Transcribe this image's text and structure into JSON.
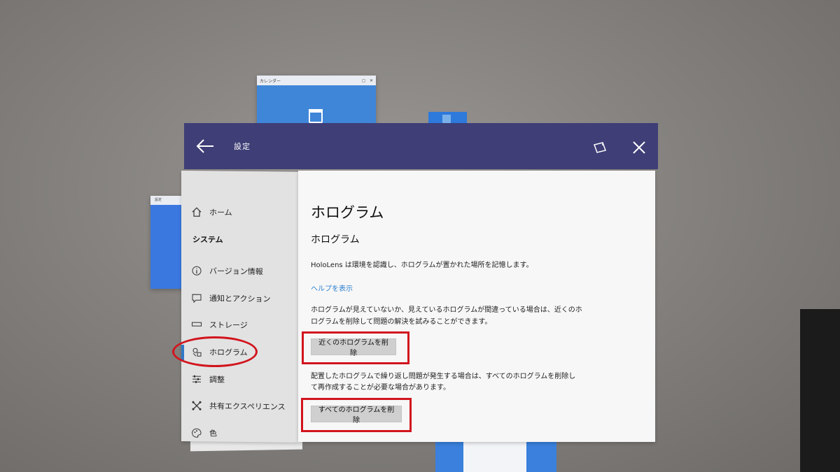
{
  "background": {
    "calendar_window": {
      "title": "カレンダー",
      "icon": "calendar-icon"
    },
    "side_window": {
      "title": "設定"
    }
  },
  "window": {
    "title": "設定",
    "back_icon": "back-arrow-icon",
    "snap_icon": "snap-window-icon",
    "close_icon": "close-icon"
  },
  "sidebar": {
    "home": {
      "label": "ホーム",
      "icon": "home-icon"
    },
    "section": "システム",
    "items": [
      {
        "label": "バージョン情報",
        "icon": "info-icon"
      },
      {
        "label": "通知とアクション",
        "icon": "notification-icon"
      },
      {
        "label": "ストレージ",
        "icon": "storage-icon"
      },
      {
        "label": "ホログラム",
        "icon": "hologram-icon",
        "active": true
      },
      {
        "label": "調整",
        "icon": "sliders-icon"
      },
      {
        "label": "共有エクスペリエンス",
        "icon": "shared-experience-icon"
      },
      {
        "label": "色",
        "icon": "palette-icon"
      }
    ]
  },
  "main": {
    "title": "ホログラム",
    "subtitle": "ホログラム",
    "description": "HoloLens は環境を認識し、ホログラムが置かれた場所を記憶します。",
    "help_link": "ヘルプを表示",
    "nearby_text_line1": "ホログラムが見えていないか、見えているホログラムが間違っている場合は、近くのホ",
    "nearby_text_line2": "ログラムを削除して問題の解決を試みることができます。",
    "nearby_button": "近くのホログラムを削除",
    "all_text_line1": "配置したホログラムで繰り返し問題が発生する場合は、すべてのホログラムを削除し",
    "all_text_line2": "て再作成することが必要な場合があります。",
    "all_button": "すべてのホログラムを削除"
  },
  "colors": {
    "titlebar": "#3f3e77",
    "accent": "#3277c7",
    "annotation": "#d2141d"
  }
}
